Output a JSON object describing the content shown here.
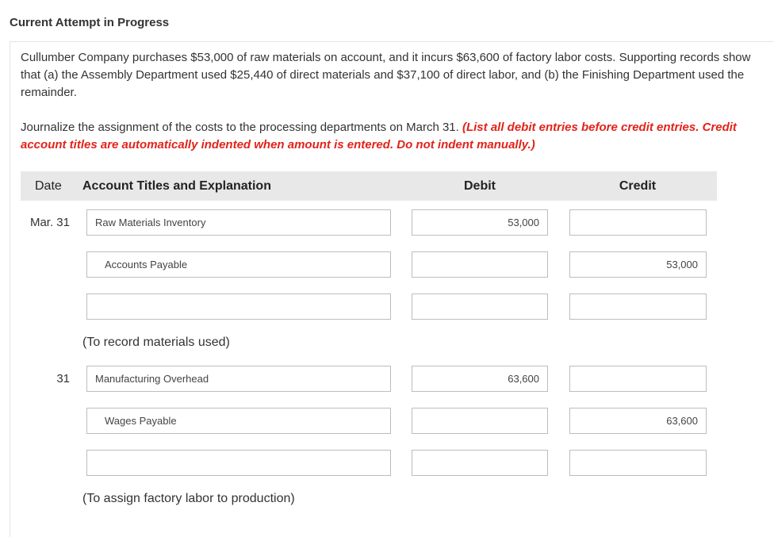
{
  "header": {
    "title": "Current Attempt in Progress"
  },
  "problem": {
    "text": "Cullumber Company purchases $53,000 of raw materials on account, and it incurs $63,600 of factory labor costs. Supporting records show that (a) the Assembly Department used $25,440 of direct materials and $37,100 of direct labor, and (b) the Finishing Department used the remainder."
  },
  "instructions": {
    "text": "Journalize the assignment of the costs to the processing departments on March 31.",
    "warning": "(List all debit entries before credit entries. Credit account titles are automatically indented when amount is entered. Do not indent manually.)"
  },
  "table": {
    "headers": {
      "date": "Date",
      "account": "Account Titles and Explanation",
      "debit": "Debit",
      "credit": "Credit"
    },
    "entries": [
      {
        "date": "Mar. 31",
        "rows": [
          {
            "account": "Raw Materials Inventory",
            "debit": "53,000",
            "credit": ""
          },
          {
            "account": "Accounts Payable",
            "debit": "",
            "credit": "53,000"
          },
          {
            "account": "",
            "debit": "",
            "credit": ""
          }
        ],
        "explanation": "(To record materials used)"
      },
      {
        "date": "31",
        "rows": [
          {
            "account": "Manufacturing Overhead",
            "debit": "63,600",
            "credit": ""
          },
          {
            "account": "Wages Payable",
            "debit": "",
            "credit": "63,600"
          },
          {
            "account": "",
            "debit": "",
            "credit": ""
          }
        ],
        "explanation": "(To assign factory labor to production)"
      }
    ]
  }
}
